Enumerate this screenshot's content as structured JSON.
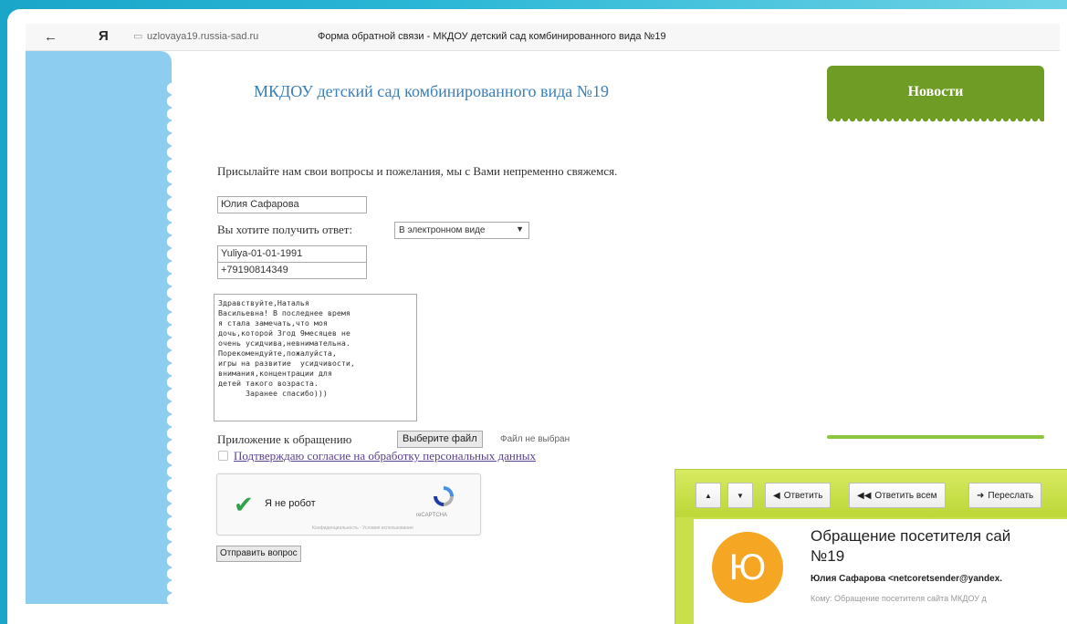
{
  "browser": {
    "back_icon": "←",
    "yandex_logo": "Я",
    "url": "uzlovaya19.russia-sad.ru",
    "page_title": "Форма обратной связи - МКДОУ детский сад комбинированного вида №19"
  },
  "site": {
    "title": "МКДОУ детский сад комбинированного вида №19",
    "news_tab": "Новости"
  },
  "form": {
    "intro": "Присылайте нам свои вопросы и пожелания, мы с Вами непременно свяжемся.",
    "name_value": "Юлия Сафарова",
    "answer_label": "Вы хотите получить ответ:",
    "answer_select": "В электронном виде",
    "email_value": "Yuliya-01-01-1991",
    "phone_value": "+79190814349",
    "message": "Здравствуйте,Наталья\nВасильевна! В последнее время\nя стала замечать,что моя\nдочь,которой 3год 9месяцев не\nочень усидчива,невнимательна.\nПорекомендуйте,пожалуйста,\nигры на развитие  усидчивости,\nвнимания,концентрации для\nдетей такого возраста.\n      Заранее спасибо)))",
    "attach_label": "Приложение к обращению",
    "file_button": "Выберите файл",
    "file_status": "Файл не выбран",
    "consent_label": "Подтверждаю согласие на обработку персональных данных",
    "captcha_label": "Я не робот",
    "captcha_brand": "reCAPTCHA",
    "captcha_terms": "Конфиденциальность - Условия использования",
    "submit": "Отправить вопрос"
  },
  "email": {
    "toolbar": {
      "up": "▲",
      "down": "▼",
      "reply": "Ответить",
      "reply_all": "Ответить всем",
      "forward": "Переслать"
    },
    "avatar_letter": "Ю",
    "subject_line1": "Обращение посетителя сай",
    "subject_line2": "№19",
    "from": "Юлия Сафарова <netcoretsender@yandex.",
    "to": "Кому: Обращение посетителя сайта МКДОУ д"
  }
}
